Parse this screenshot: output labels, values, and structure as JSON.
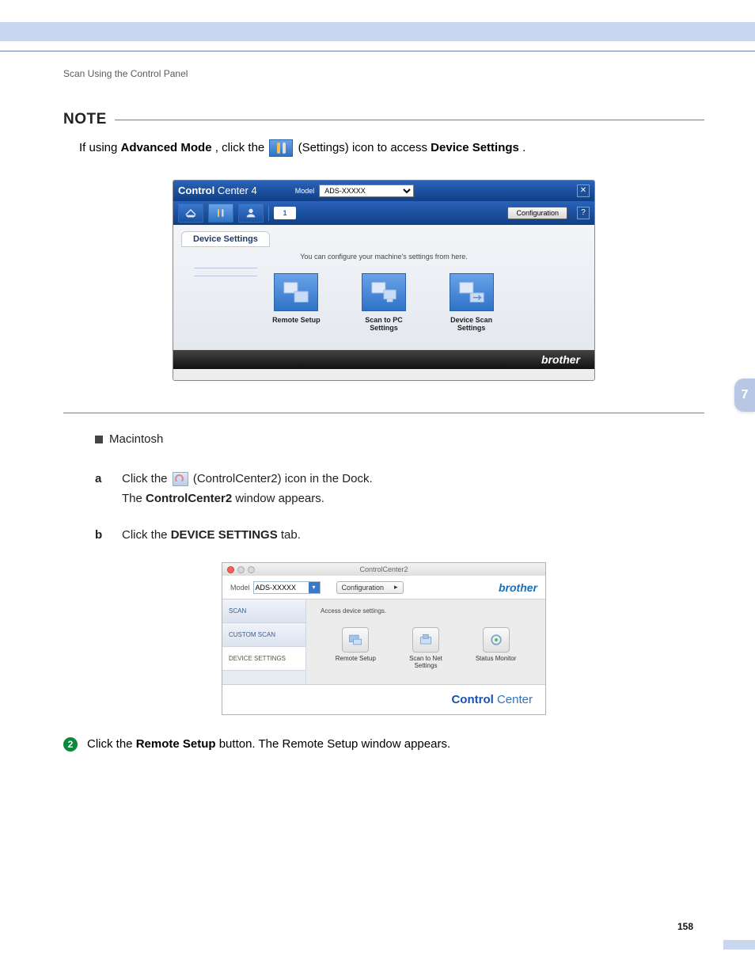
{
  "header": {
    "breadcrumb": "Scan Using the Control Panel"
  },
  "note": {
    "title": "NOTE",
    "line_before": "If using ",
    "advanced": "Advanced Mode",
    "line_mid": ", click the ",
    "line_after": " (Settings) icon to access ",
    "device_settings": "Device Settings",
    "period": "."
  },
  "cc4": {
    "title_bold": "Control",
    "title_thin": " Center 4",
    "model_label": "Model",
    "model_value": "ADS-XXXXX",
    "badge": "1",
    "config_button": "Configuration",
    "tab": "Device Settings",
    "subtext": "You can configure your machine's settings from here.",
    "tiles": [
      {
        "label": "Remote Setup"
      },
      {
        "label": "Scan to PC\nSettings"
      },
      {
        "label": "Device Scan\nSettings"
      }
    ],
    "brand": "brother"
  },
  "mac_bullet": "Macintosh",
  "step_a": {
    "letter": "a",
    "text_before": "Click the ",
    "text_after": " (ControlCenter2) icon in the Dock.",
    "line2_before": "The ",
    "line2_bold": "ControlCenter2",
    "line2_after": " window appears."
  },
  "step_b": {
    "letter": "b",
    "text_before": "Click the ",
    "text_bold": "DEVICE SETTINGS",
    "text_after": " tab."
  },
  "cc2": {
    "window_title": "ControlCenter2",
    "model_label": "Model",
    "model_value": "ADS-XXXXX",
    "config_button": "Configuration",
    "brand": "brother",
    "tabs": [
      "SCAN",
      "CUSTOM SCAN",
      "DEVICE SETTINGS"
    ],
    "desc": "Access device settings.",
    "tiles": [
      {
        "label": "Remote Setup"
      },
      {
        "label": "Scan to Net\nSettings"
      },
      {
        "label": "Status Monitor"
      }
    ],
    "footer_bold": "Control",
    "footer_thin": " Center"
  },
  "step2": {
    "number": "2",
    "text_before": "Click the ",
    "text_bold": "Remote Setup",
    "text_after": " button. The Remote Setup window appears."
  },
  "side_tab": "7",
  "page_number": "158"
}
